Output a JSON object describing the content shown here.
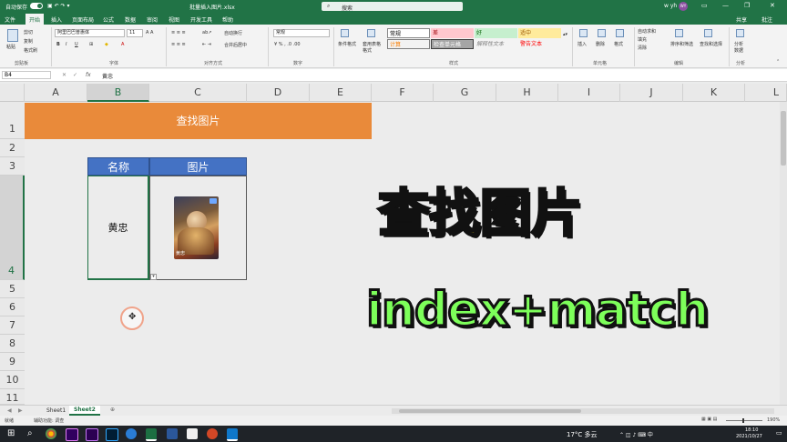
{
  "titlebar": {
    "autosave": "自动保存",
    "filename": "批量插入图片.xlsx",
    "search_placeholder": "搜索",
    "user": "w yh",
    "avatar": "WY"
  },
  "menu": [
    "文件",
    "开始",
    "插入",
    "页面布局",
    "公式",
    "数据",
    "审阅",
    "视图",
    "开发工具",
    "帮助"
  ],
  "menu_right": {
    "share": "共享",
    "comment": "批注"
  },
  "ribbon": {
    "clipboard": {
      "group": "剪贴板",
      "paste": "粘贴",
      "cut": "剪切",
      "copy": "复制",
      "format_painter": "格式刷"
    },
    "font": {
      "group": "字体",
      "font_name": "阿里巴巴普惠体",
      "font_size": "11"
    },
    "alignment": {
      "group": "对齐方式",
      "wrap": "自动换行",
      "merge": "合并后居中"
    },
    "number": {
      "group": "数字",
      "format": "常规"
    },
    "styles": {
      "group": "样式",
      "conditional": "条件格式",
      "table": "套用表格格式",
      "cell_styles": [
        "常规",
        "差",
        "好",
        "适中",
        "计算",
        "检查单元格",
        "解释性文本",
        "警告文本"
      ]
    },
    "cells": {
      "group": "单元格",
      "insert": "插入",
      "delete": "删除",
      "format": "格式"
    },
    "editing": {
      "group": "编辑",
      "autosum": "自动求和",
      "fill": "填充",
      "clear": "清除",
      "sort": "排序和筛选",
      "find": "查找和选择"
    },
    "analysis": {
      "group": "分析",
      "analyze": "分析数据"
    }
  },
  "formula_bar": {
    "name_box": "B4",
    "fx": "fx",
    "value": "黄忠"
  },
  "columns": [
    "A",
    "B",
    "C",
    "D",
    "E",
    "F",
    "G",
    "H",
    "I",
    "J",
    "K",
    "L"
  ],
  "rows": [
    "1",
    "2",
    "3",
    "4",
    "5",
    "6",
    "7",
    "8",
    "9",
    "10",
    "11"
  ],
  "sheet": {
    "banner": "查找图片",
    "table_headers": [
      "名称",
      "图片"
    ],
    "name_value": "黄忠",
    "image_caption": "黄忠"
  },
  "overlay": {
    "heading": "查找图片",
    "formula": "index+match"
  },
  "tabs": [
    "Sheet1",
    "Sheet2"
  ],
  "status": {
    "ready": "就绪",
    "accessibility": "辅助功能: 调查",
    "zoom": "190%"
  },
  "taskbar": {
    "weather": "17°C 多云",
    "time": "18:10",
    "date": "2021/10/27"
  },
  "colors": {
    "excel_green": "#217346",
    "banner": "#e98a3a",
    "table_header": "#4472c4",
    "overlay_yellow": "#ffe51a",
    "overlay_green": "#7dff5a"
  }
}
